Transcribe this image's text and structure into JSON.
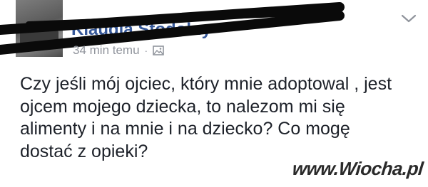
{
  "post": {
    "author_name": "Klaudia Stodolny",
    "timestamp": "34 min temu",
    "separator": "·",
    "audience_icon": "photo-icon",
    "options_icon": "chevron-down-icon",
    "text": "Czy jeśli mój ojciec, który mnie adoptowal , jest\nojcem mojego dziecka, to nalezom mi się\nalimenty i na mnie i na dziecko? Co mogę\ndostać  z opieki?"
  },
  "watermark": "www.Wiocha.pl",
  "colors": {
    "name_link": "#365899",
    "meta_gray": "#90949c",
    "body_text": "#1d2129",
    "scribble": "#0a0a0a"
  }
}
